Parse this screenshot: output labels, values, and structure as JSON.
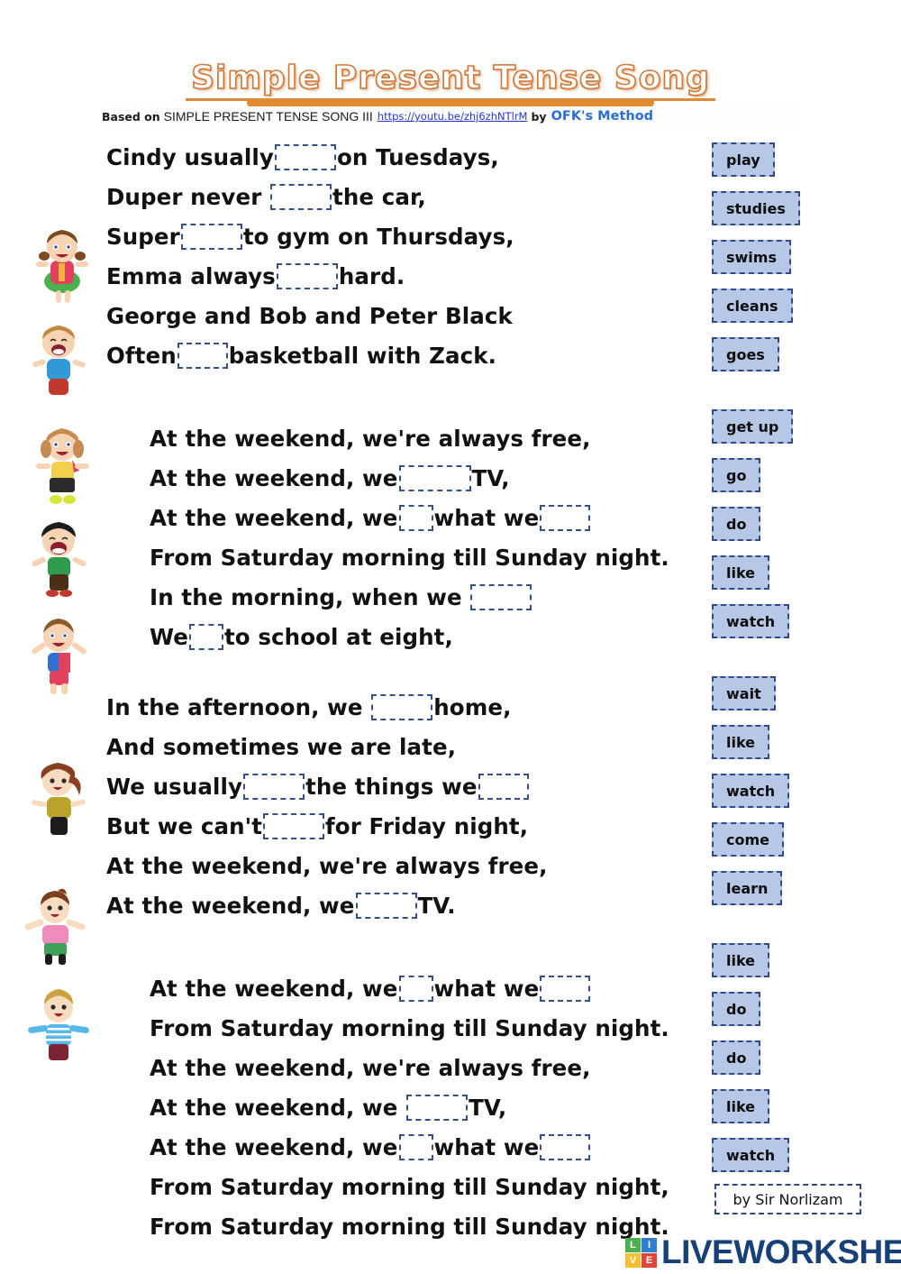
{
  "header": {
    "title": "Simple Present Tense Song",
    "credit_prefix": "Based on",
    "credit_source": "SIMPLE PRESENT TENSE SONG III",
    "credit_url": "https://youtu.be/zhj6zhNTlrM",
    "credit_by": "by",
    "credit_method": "OFK's Method"
  },
  "lyrics": {
    "stanza1": [
      {
        "id": "l1",
        "parts": [
          "Cindy usually",
          "BLANK:md",
          "on Tuesdays,"
        ]
      },
      {
        "id": "l2",
        "parts": [
          "Duper never ",
          "BLANK:md",
          "the car,"
        ]
      },
      {
        "id": "l3",
        "parts": [
          "Super",
          "BLANK:md",
          "to gym on Thursdays,"
        ]
      },
      {
        "id": "l4",
        "parts": [
          "Emma always",
          "BLANK:md",
          "hard."
        ]
      },
      {
        "id": "l5",
        "parts": [
          "George and Bob and Peter Black"
        ]
      },
      {
        "id": "l6",
        "parts": [
          "Often",
          "BLANK:sm",
          "basketball with Zack."
        ]
      }
    ],
    "stanza2": [
      {
        "id": "l7",
        "parts": [
          "At the weekend, we're always free,"
        ]
      },
      {
        "id": "l8",
        "parts": [
          "At the weekend, we",
          "BLANK:lg",
          "TV,"
        ]
      },
      {
        "id": "l9",
        "parts": [
          "At the weekend, we",
          "BLANK:xs",
          "what we",
          "BLANK:sm"
        ]
      },
      {
        "id": "l10",
        "parts": [
          "From Saturday morning till Sunday night."
        ]
      },
      {
        "id": "l11",
        "parts": [
          "In the morning, when we ",
          "BLANK:md"
        ]
      },
      {
        "id": "l12",
        "parts": [
          "We",
          "BLANK:xs",
          "to school at eight,"
        ]
      }
    ],
    "stanza3": [
      {
        "id": "l13",
        "parts": [
          "In the afternoon, we ",
          "BLANK:md",
          "home,"
        ]
      },
      {
        "id": "l14",
        "parts": [
          "And sometimes we are late,"
        ]
      },
      {
        "id": "l15",
        "parts": [
          "We usually",
          "BLANK:md",
          "the things we",
          "BLANK:sm"
        ]
      },
      {
        "id": "l16",
        "parts": [
          "But we can't",
          "BLANK:md",
          "for Friday night,"
        ]
      },
      {
        "id": "l17",
        "parts": [
          "At the weekend, we're always free,"
        ]
      },
      {
        "id": "l18",
        "parts": [
          "At the weekend, we",
          "BLANK:md",
          "TV."
        ]
      }
    ],
    "stanza4": [
      {
        "id": "l19",
        "parts": [
          "At the weekend, we",
          "BLANK:xs",
          "what we",
          "BLANK:sm"
        ]
      },
      {
        "id": "l20",
        "parts": [
          "From Saturday morning till Sunday night."
        ]
      },
      {
        "id": "l21",
        "parts": [
          "At the weekend, we're always free,"
        ]
      },
      {
        "id": "l22",
        "parts": [
          "At the weekend, we ",
          "BLANK:md",
          "TV,"
        ]
      },
      {
        "id": "l23",
        "parts": [
          "At the weekend, we",
          "BLANK:xs",
          "what we",
          "BLANK:sm"
        ]
      },
      {
        "id": "l24",
        "parts": [
          "From Saturday morning till Sunday night,"
        ]
      },
      {
        "id": "l25",
        "parts": [
          "From Saturday morning till Sunday night."
        ]
      }
    ]
  },
  "wordbank": {
    "groups": [
      {
        "items": [
          "play",
          "studies",
          "swims",
          "cleans",
          "goes"
        ]
      },
      {
        "items": [
          "get up",
          "go",
          "do",
          "like",
          "watch"
        ]
      },
      {
        "items": [
          "wait",
          "like",
          "watch",
          "come",
          "learn"
        ]
      },
      {
        "items": [
          "like",
          "do",
          "do",
          "like",
          "watch"
        ]
      }
    ]
  },
  "signature": "by Sir Norlizam",
  "footer": {
    "logo_blocks": [
      "L",
      "I",
      "V",
      "E"
    ],
    "logo_text": "LIVEWORKSHEETS"
  },
  "colors": {
    "title_outline": "#d2793a",
    "title_underline": "#e08b30",
    "blank_border": "#34508c",
    "wordbank_fill": "#b7c7e6",
    "wordbank_border": "#2f4a87",
    "link": "#2439c9",
    "method": "#2b6ed9",
    "logo_text": "#164178"
  }
}
